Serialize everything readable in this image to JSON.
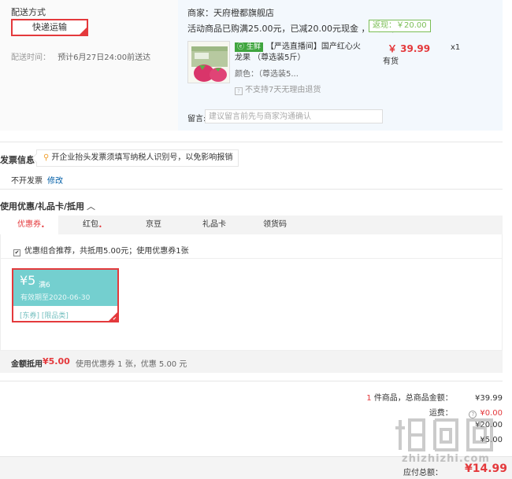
{
  "shipping": {
    "title": "配送方式",
    "option_label": "快递运输",
    "time_label": "配送时间：",
    "time_value": "预计6月27日24:00前送达"
  },
  "merchant": {
    "name": "商家：天府橙都旗舰店",
    "promo": "活动商品已购满25.00元，已减20.00元现金 ，已免邮",
    "cashback": "返现：￥20.00"
  },
  "product": {
    "tag": "生鲜",
    "title": "【严选直播间】国产红心火龙果 （尊选装5斤）",
    "color_label": "颜色：",
    "color_value": "（尊选装5...",
    "return_policy": "不支持7天无理由退货",
    "price": "￥ 39.99",
    "stock": "有货",
    "qty": "x1"
  },
  "memo": {
    "label": "留言:",
    "placeholder": "建议留言前先与商家沟通确认"
  },
  "invoice": {
    "title": "发票信息",
    "tip": "开企业抬头发票须填写纳税人识别号，以免影响报销",
    "status": "不开发票",
    "edit": "修改"
  },
  "coupons": {
    "title": "使用优惠/礼品卡/抵用",
    "tabs": [
      {
        "label": "优惠券",
        "dot": "•"
      },
      {
        "label": "红包",
        "dot": "•"
      },
      {
        "label": "京豆"
      },
      {
        "label": "礼品卡"
      },
      {
        "label": "领货码"
      }
    ],
    "combo": "优惠组合推荐，共抵用5.00元；使用优惠券1张",
    "card": {
      "amount": "¥5",
      "condition": "满6",
      "expire": "有效期至2020-06-30",
      "tags": "[东券]  [限品类]"
    },
    "deduct_label": "金额抵用",
    "deduct_amount": "¥5.00",
    "deduct_desc": "使用优惠券 1 张，优惠 5.00 元"
  },
  "summary": {
    "count": "1",
    "count_suffix": "件商品，总商品金额：",
    "total_goods": "¥39.99",
    "shipping_label": "运费：",
    "shipping_value": "¥0.00",
    "row3_value": "¥20.00",
    "row4_value": "¥5.00",
    "payable_label": "应付总额：",
    "payable_value": "¥14.99"
  },
  "watermark": {
    "text": "zhizhizhi.com"
  },
  "colors": {
    "accent_red": "#e4393c",
    "coupon_teal": "#74cfcf",
    "fresh_green": "#3fa53f",
    "link_blue": "#005ea7"
  }
}
